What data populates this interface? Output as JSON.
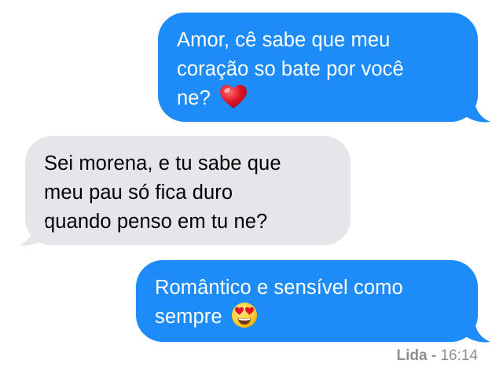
{
  "conversation": {
    "messages": [
      {
        "direction": "sent",
        "lines": [
          "Amor, cê sabe que meu",
          "coração so bate por você",
          "ne?"
        ],
        "emoji": "red-heart"
      },
      {
        "direction": "received",
        "lines": [
          "Sei morena, e tu sabe que",
          "meu pau só fica duro",
          "quando penso em tu ne?"
        ]
      },
      {
        "direction": "sent",
        "lines": [
          "Romântico e sensível como",
          "sempre"
        ],
        "emoji": "heart-eyes-face"
      }
    ],
    "status": {
      "contact": "Lida",
      "separator": " - ",
      "time": "16:14"
    }
  },
  "colors": {
    "sent_bubble": "#1d8cf8",
    "received_bubble": "#e6e5ea",
    "status_text": "#8e8e93"
  }
}
